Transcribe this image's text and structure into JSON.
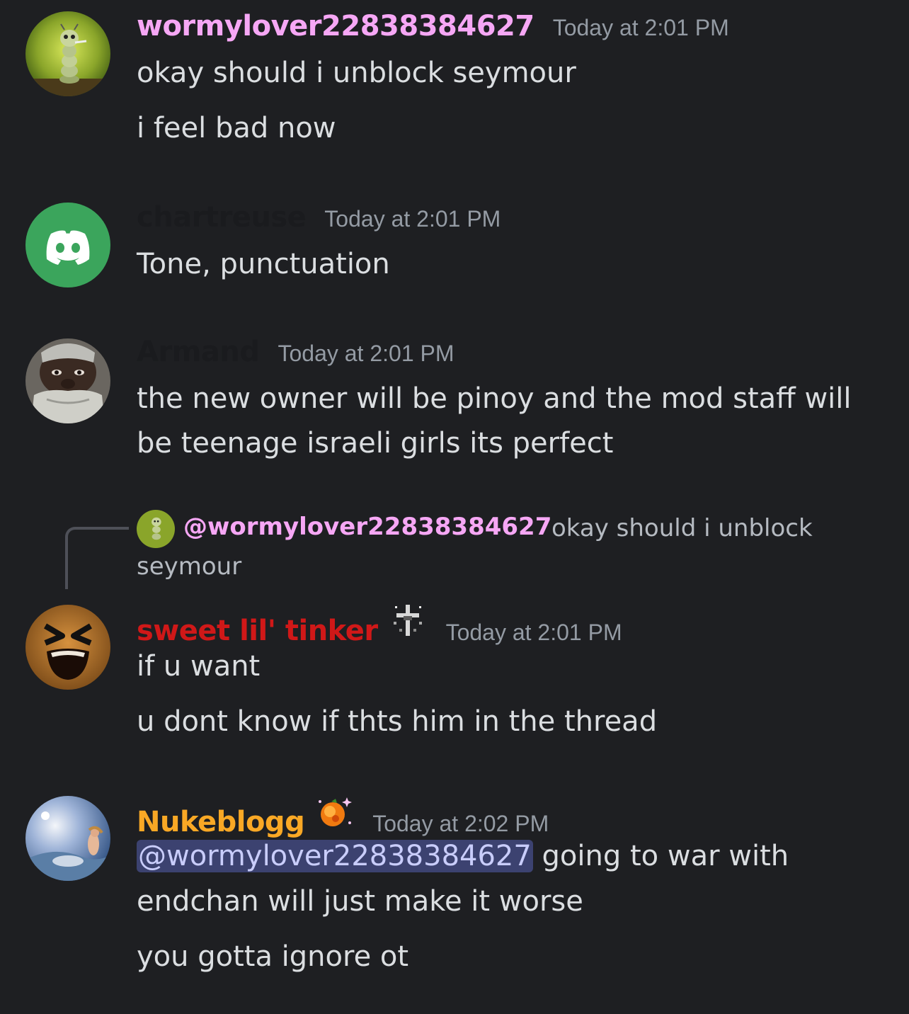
{
  "messages": [
    {
      "username": "wormylover22838384627",
      "username_color": "#f6a7f5",
      "timestamp": "Today at 2:01 PM",
      "avatar_icon": "caterpillar-smoking-icon",
      "lines": [
        "okay should i unblock seymour",
        "i feel bad now"
      ]
    },
    {
      "username": "chartreuse",
      "username_color": "#1a1b1e",
      "timestamp": "Today at 2:01 PM",
      "avatar_icon": "discord-logo-icon",
      "avatar_color": "#3ba55c",
      "lines": [
        "Tone, punctuation"
      ]
    },
    {
      "username": "Armand",
      "username_color": "#1a1b1e",
      "timestamp": "Today at 2:01 PM",
      "avatar_icon": "bearded-man-photo-icon",
      "lines": [
        "the new owner will be pinoy and the mod staff will",
        "be teenage israeli girls its perfect"
      ]
    },
    {
      "reply": {
        "username": "@wormylover22838384627",
        "text_line1": "okay should i unblock",
        "text_line2": "seymour"
      },
      "username": "sweet lil' tinker",
      "username_color": "#d01818",
      "badge_icon": "pixel-cross-icon",
      "timestamp": "Today at 2:01 PM",
      "avatar_icon": "laughing-face-icon",
      "lines": [
        "if u want",
        "u dont know if thts him in the thread"
      ]
    },
    {
      "username": "Nukeblogg",
      "username_color": "#f9a825",
      "badge_icon": "sparkle-orange-icon",
      "timestamp": "Today at 2:02 PM",
      "avatar_icon": "fantasy-painting-icon",
      "mention": "@wormylover22838384627",
      "line1_after_mention": " going to war with",
      "lines": [
        "endchan will just make it worse",
        "you gotta ignore ot"
      ]
    }
  ]
}
